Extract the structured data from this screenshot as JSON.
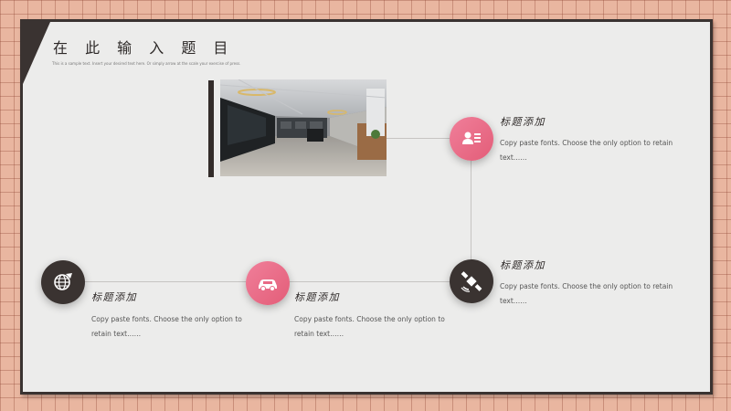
{
  "slide": {
    "title": "在 此 输 入 题 目",
    "subtitle": "This is a sample text. Insert your desired text here. Or simply arrow at the scale your exercise of press."
  },
  "items": [
    {
      "heading": "标题添加",
      "desc": "Copy paste fonts. Choose the only option to retain text……",
      "icon": "id-card-icon",
      "color": "pink"
    },
    {
      "heading": "标题添加",
      "desc": "Copy paste fonts. Choose the only option to retain text……",
      "icon": "satellite-icon",
      "color": "dark"
    },
    {
      "heading": "标题添加",
      "desc": "Copy paste fonts. Choose the only option to retain text……",
      "icon": "car-icon",
      "color": "pink"
    },
    {
      "heading": "标题添加",
      "desc": "Copy paste fonts. Choose the only option to retain text……",
      "icon": "globe-icon",
      "color": "dark"
    }
  ],
  "colors": {
    "pink": "#e86a85",
    "dark": "#3a3331",
    "background": "#e9b6a0"
  }
}
